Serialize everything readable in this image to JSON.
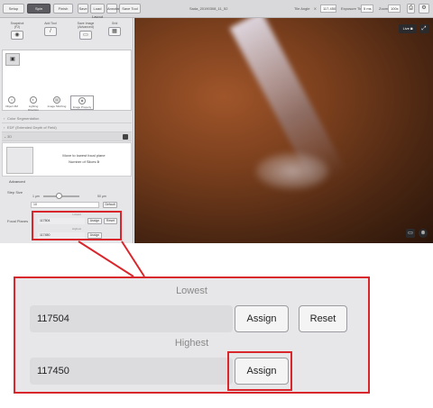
{
  "topbar": {
    "tabs": [
      "Setup",
      "Spin",
      "Finish"
    ],
    "active_tab": "Spin",
    "tool_buttons": [
      "Save",
      "Load Layout",
      "Annotate",
      "Save Tool"
    ],
    "file_title": "Sada_20190308_11_52",
    "tile_label": "Tile Angle",
    "x_label": "X",
    "x_value": "117,450",
    "y_label": "Exposure Time",
    "y_value": "5 ms",
    "zoom_label": "Zoom",
    "zoom_value": "100x"
  },
  "toolbar": {
    "tools": [
      {
        "label": "Snapshot",
        "sublabel": "(F2)",
        "icon": "camera-icon"
      },
      {
        "label": "Add Tool",
        "sublabel": "",
        "icon": "pen-icon"
      },
      {
        "label": "Save Image",
        "sublabel": "(Advanced)",
        "icon": "save-icon"
      },
      {
        "label": "Grid",
        "sublabel": "",
        "icon": "grid-icon"
      }
    ]
  },
  "tabs": [
    "Object ZM",
    "Lighting Direction",
    "Image Stitching",
    "Image Property"
  ],
  "accordion": {
    "items": [
      "Color Segmentation",
      "EDF (Extended Depth of Field)",
      "3D"
    ],
    "focus_text": "Move to lowest focal plane",
    "slices_label": "Number of Slices",
    "slices_value": "0",
    "advanced_label": "Advanced",
    "step_size_label": "Step Size",
    "step_min": "1 µm",
    "step_max": "50 µm",
    "step_value": "10",
    "default_label": "Default",
    "focal_planes_label": "Focal Planes"
  },
  "focal": {
    "lowest_label": "Lowest",
    "lowest_value": "117504",
    "highest_label": "Highest",
    "highest_value": "117450",
    "assign_label": "Assign",
    "reset_label": "Reset"
  },
  "viewer": {
    "live_label": "Live"
  },
  "colors": {
    "highlight": "#d9262c",
    "panel_bg": "#e6e6e8"
  }
}
